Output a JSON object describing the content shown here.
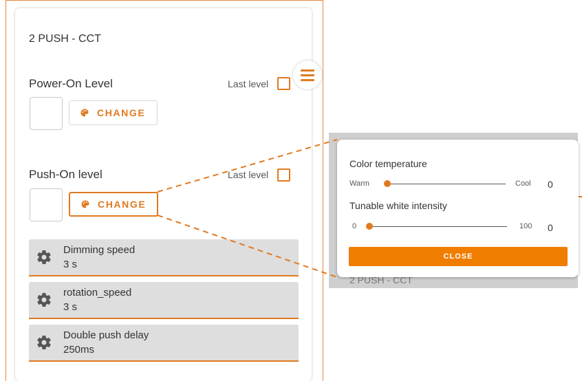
{
  "panel": {
    "title": "2 PUSH - CCT",
    "power_on": {
      "label": "Power-On Level",
      "last_level_label": "Last level",
      "change_label": "CHANGE"
    },
    "push_on": {
      "label": "Push-On level",
      "last_level_label": "Last level",
      "change_label": "CHANGE"
    },
    "settings": [
      {
        "name": "Dimming speed",
        "value": "3 s"
      },
      {
        "name": "rotation_speed",
        "value": "3 s"
      },
      {
        "name": "Double push delay",
        "value": "250ms"
      }
    ]
  },
  "popup": {
    "color_temperature": {
      "label": "Color temperature",
      "min_label": "Warm",
      "max_label": "Cool",
      "value": "0",
      "level": 0
    },
    "intensity": {
      "label": "Tunable white intensity",
      "min_label": "0",
      "max_label": "100",
      "value": "0",
      "level": 0
    },
    "close_label": "CLOSE",
    "background_text": "2 PUSH - CCT"
  },
  "colors": {
    "accent": "#e07a1f",
    "close_button": "#f07d00"
  }
}
